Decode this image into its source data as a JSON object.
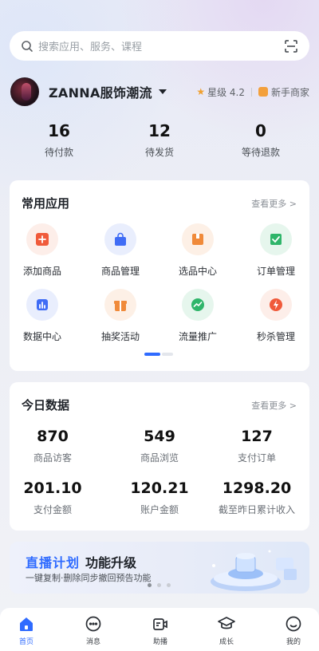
{
  "search": {
    "placeholder": "搜索应用、服务、课程"
  },
  "shop": {
    "name": "ZANNA服饰潮流",
    "rating_label": "星级 4.2",
    "merchant_tag": "新手商家"
  },
  "order_stats": [
    {
      "value": "16",
      "label": "待付款"
    },
    {
      "value": "12",
      "label": "待发货"
    },
    {
      "value": "0",
      "label": "等待退款"
    }
  ],
  "common_apps": {
    "title": "常用应用",
    "more": "查看更多 >",
    "items": [
      {
        "label": "添加商品",
        "icon": "add-product-icon",
        "color": "#f05a3a",
        "bg": "#fdeee9"
      },
      {
        "label": "商品管理",
        "icon": "bag-icon",
        "color": "#3f6cf5",
        "bg": "#e9eefd"
      },
      {
        "label": "选品中心",
        "icon": "box-icon",
        "color": "#f08a3a",
        "bg": "#fdf0e6"
      },
      {
        "label": "订单管理",
        "icon": "order-icon",
        "color": "#2fb56a",
        "bg": "#e6f6ed"
      },
      {
        "label": "数据中心",
        "icon": "chart-icon",
        "color": "#3f6cf5",
        "bg": "#e9eefd"
      },
      {
        "label": "抽奖活动",
        "icon": "gift-icon",
        "color": "#f08a3a",
        "bg": "#fdf0e6"
      },
      {
        "label": "流量推广",
        "icon": "trend-icon",
        "color": "#2fb56a",
        "bg": "#e6f6ed"
      },
      {
        "label": "秒杀管理",
        "icon": "flash-icon",
        "color": "#f05a3a",
        "bg": "#fdeee9"
      }
    ]
  },
  "today_data": {
    "title": "今日数据",
    "more": "查看更多 >",
    "items": [
      {
        "value": "870",
        "label": "商品访客"
      },
      {
        "value": "549",
        "label": "商品浏览"
      },
      {
        "value": "127",
        "label": "支付订单"
      },
      {
        "value": "201.10",
        "label": "支付金额"
      },
      {
        "value": "120.21",
        "label": "账户金额"
      },
      {
        "value": "1298.20",
        "label": "截至昨日累计收入"
      }
    ]
  },
  "banner": {
    "title_accent": "直播计划",
    "title_main": "功能升级",
    "subtitle": "一键复制·删除同步撤回预告功能"
  },
  "tabbar": [
    {
      "label": "首页",
      "icon": "home-icon",
      "active": true
    },
    {
      "label": "消息",
      "icon": "message-icon",
      "active": false
    },
    {
      "label": "助播",
      "icon": "live-assist-icon",
      "active": false
    },
    {
      "label": "成长",
      "icon": "graduation-cap-icon",
      "active": false
    },
    {
      "label": "我的",
      "icon": "profile-icon",
      "active": false
    }
  ],
  "colors": {
    "accent": "#2f6bff",
    "star": "#f0a030"
  }
}
